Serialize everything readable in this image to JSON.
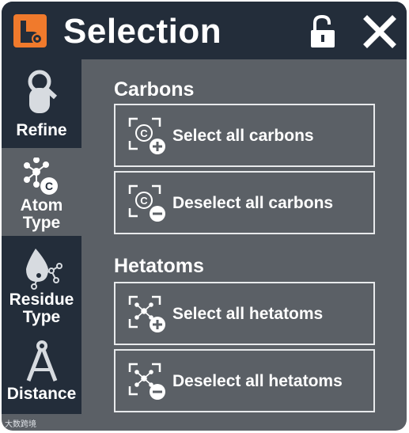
{
  "header": {
    "title": "Selection",
    "app_icon": "hand-gear-icon",
    "lock_icon": "unlock-icon",
    "close_icon": "close-icon"
  },
  "sidebar": {
    "tabs": [
      {
        "id": "refine",
        "label": "Refine",
        "icon": "refine-search-icon",
        "active": false
      },
      {
        "id": "atom-type",
        "label_line1": "Atom",
        "label_line2": "Type",
        "icon": "atom-carbon-icon",
        "active": true
      },
      {
        "id": "residue-type",
        "label_line1": "Residue",
        "label_line2": "Type",
        "icon": "residue-drop-icon",
        "active": false
      },
      {
        "id": "distance",
        "label": "Distance",
        "icon": "compass-icon",
        "active": false
      }
    ],
    "watermark": "大数跨境"
  },
  "main": {
    "carbons": {
      "title": "Carbons",
      "select_label": "Select all carbons",
      "deselect_label": "Deselect all carbons"
    },
    "hetatoms": {
      "title": "Hetatoms",
      "select_label": "Select all hetatoms",
      "deselect_label": "Deselect all hetatoms"
    }
  },
  "colors": {
    "panel": "#5b6066",
    "header": "#232d3a",
    "accent": "#f07a2c",
    "text": "#ffffff"
  }
}
